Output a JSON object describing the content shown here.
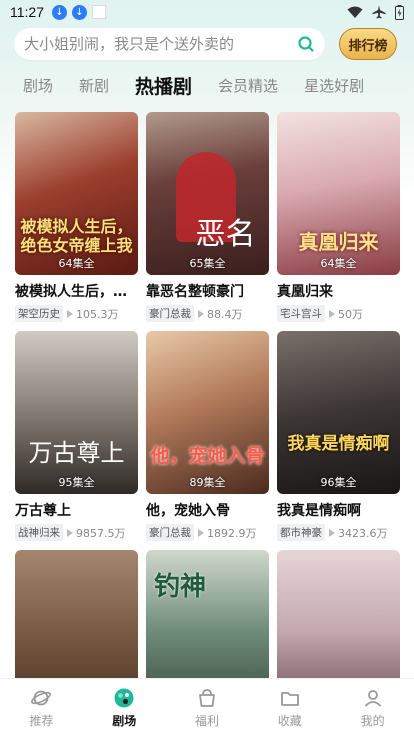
{
  "status": {
    "time": "11:27"
  },
  "search": {
    "placeholder": "大小姐别闹，我只是个送外卖的",
    "rank_label": "排行榜"
  },
  "tabs": [
    {
      "label": "剧场"
    },
    {
      "label": "新剧"
    },
    {
      "label": "热播剧",
      "active": true
    },
    {
      "label": "会员精选"
    },
    {
      "label": "星选好剧"
    }
  ],
  "cards": [
    {
      "title": "被模拟人生后，绝色女帝缠上我",
      "tag": "架空历史",
      "views": "105.3万",
      "episodes": "64集全",
      "poster_text": "被模拟人生后，绝色女帝缠上我",
      "color": "#7a2b22"
    },
    {
      "title": "靠恶名整顿豪门",
      "tag": "豪门总裁",
      "views": "88.4万",
      "episodes": "65集全",
      "poster_text": "恶名",
      "color": "#5a3a38"
    },
    {
      "title": "真凰归来",
      "tag": "宅斗宫斗",
      "views": "50万",
      "episodes": "64集全",
      "poster_text": "真凰归来",
      "color": "#c9a0a3"
    },
    {
      "title": "万古尊上",
      "tag": "战神归来",
      "views": "9857.5万",
      "episodes": "95集全",
      "poster_text": "万古尊上",
      "color": "#6e6660"
    },
    {
      "title": "他，宠她入骨",
      "tag": "豪门总裁",
      "views": "1892.9万",
      "episodes": "89集全",
      "poster_text": "他，宠她入骨",
      "color": "#a36e55"
    },
    {
      "title": "我真是情痴啊",
      "tag": "都市神豪",
      "views": "3423.6万",
      "episodes": "96集全",
      "poster_text": "我真是情痴啊",
      "color": "#3b3534"
    },
    {
      "title": "",
      "tag": "",
      "views": "",
      "episodes": "",
      "poster_text": "",
      "color": "#7a5a45"
    },
    {
      "title": "",
      "tag": "",
      "views": "",
      "episodes": "",
      "poster_text": "钓神",
      "color": "#4d6b5a"
    },
    {
      "title": "",
      "tag": "",
      "views": "",
      "episodes": "",
      "poster_text": "",
      "color": "#c4a8b0"
    }
  ],
  "nav": [
    {
      "label": "推荐",
      "icon": "planet-icon"
    },
    {
      "label": "剧场",
      "icon": "theater-icon",
      "active": true
    },
    {
      "label": "福利",
      "icon": "gift-bag-icon"
    },
    {
      "label": "收藏",
      "icon": "folder-icon"
    },
    {
      "label": "我的",
      "icon": "user-icon"
    }
  ]
}
